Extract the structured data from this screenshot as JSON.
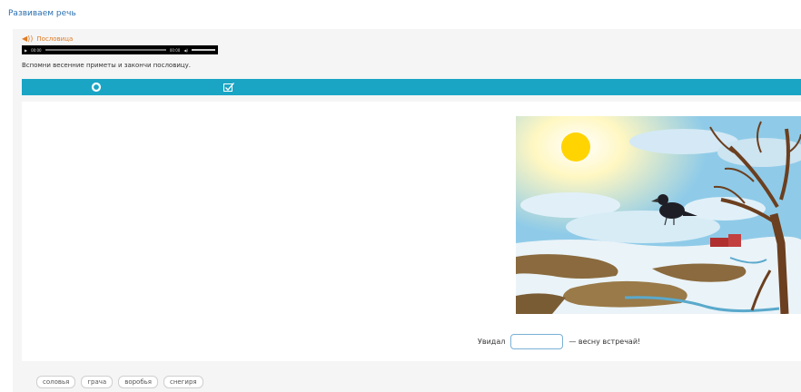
{
  "page_title": "Развиваем речь",
  "audio": {
    "label": "Пословица",
    "time_current": "00:00",
    "time_total": "00:00"
  },
  "instruction": "Вспомни весенние приметы и закончи пословицу.",
  "sentence": {
    "before": "Увидал",
    "after": "— весну встречай!"
  },
  "words": [
    "соловья",
    "грача",
    "воробья",
    "снегиря"
  ],
  "colors": {
    "toolbar": "#1aa5c4",
    "title": "#2a6fb0",
    "audio_label": "#e07b22"
  },
  "icons": {
    "reset": "reset-icon",
    "check": "check-icon"
  }
}
